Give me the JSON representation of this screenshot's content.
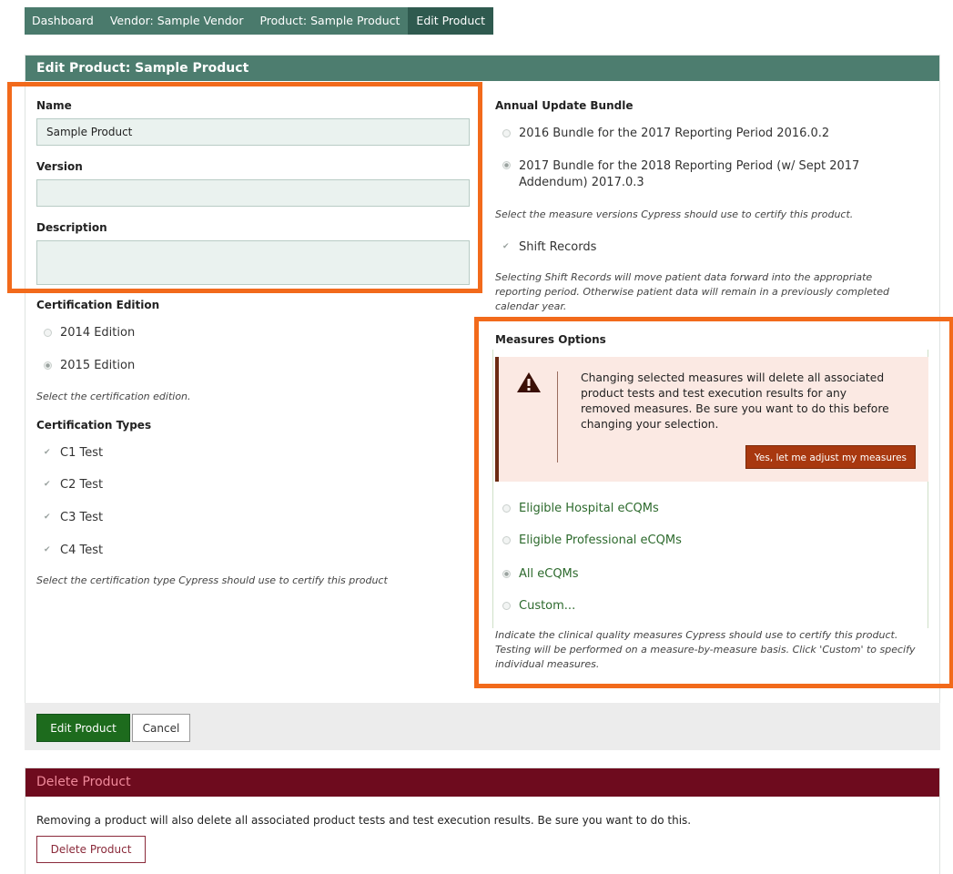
{
  "breadcrumb": {
    "items": [
      "Dashboard",
      "Vendor: Sample Vendor",
      "Product: Sample Product",
      "Edit Product"
    ]
  },
  "panel": {
    "title": "Edit Product: Sample Product"
  },
  "form": {
    "name_label": "Name",
    "name_value": "Sample Product",
    "version_label": "Version",
    "version_value": "",
    "description_label": "Description",
    "description_value": ""
  },
  "certification_edition": {
    "label": "Certification Edition",
    "options": [
      "2014 Edition",
      "2015 Edition"
    ],
    "selected": "2015 Edition",
    "help": "Select the certification edition."
  },
  "certification_types": {
    "label": "Certification Types",
    "options": [
      "C1 Test",
      "C2 Test",
      "C3 Test",
      "C4 Test"
    ],
    "checked": [
      "C1 Test",
      "C2 Test",
      "C3 Test",
      "C4 Test"
    ],
    "help": "Select the certification type Cypress should use to certify this product"
  },
  "annual_update_bundle": {
    "label": "Annual Update Bundle",
    "options": [
      "2016 Bundle for the 2017 Reporting Period 2016.0.2",
      "2017 Bundle for the 2018 Reporting Period (w/ Sept 2017 Addendum) 2017.0.3"
    ],
    "selected": "2017 Bundle for the 2018 Reporting Period (w/ Sept 2017 Addendum) 2017.0.3",
    "help": "Select the measure versions Cypress should use to certify this product."
  },
  "shift_records": {
    "label": "Shift Records",
    "checked": true,
    "help": "Selecting Shift Records will move patient data forward into the appropriate reporting period. Otherwise patient data will remain in a previously completed calendar year."
  },
  "measures_options": {
    "label": "Measures Options",
    "warning_text": "Changing selected measures will delete all associated product tests and test execution results for any removed measures. Be sure you want to do this before changing your selection.",
    "warning_button": "Yes, let me adjust my measures",
    "options": [
      "Eligible Hospital eCQMs",
      "Eligible Professional eCQMs",
      "All eCQMs",
      "Custom..."
    ],
    "selected": "All eCQMs",
    "help": "Indicate the clinical quality measures Cypress should use to certify this product. Testing will be performed on a measure-by-measure basis. Click 'Custom' to specify individual measures."
  },
  "footer": {
    "submit": "Edit Product",
    "cancel": "Cancel"
  },
  "delete": {
    "title": "Delete Product",
    "text": "Removing a product will also delete all associated product tests and test execution results. Be sure you want to do this.",
    "button": "Delete Product"
  },
  "colors": {
    "header_green": "#4d7d6f",
    "primary_green": "#1d6b1d",
    "delete_header": "#6e0b1e",
    "warning_button": "#a8380f",
    "highlight_orange": "#f26a1b"
  }
}
